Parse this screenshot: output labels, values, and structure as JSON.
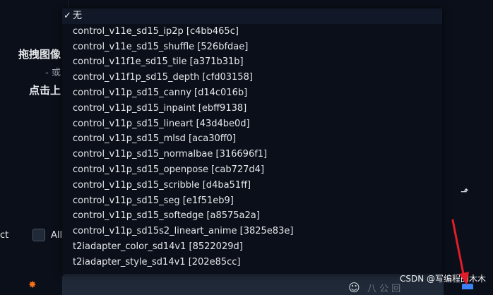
{
  "upload": {
    "line1": "拖拽图像",
    "line2": "- 或",
    "line3": "点击上"
  },
  "options": {
    "check_glyph": "✓",
    "items": [
      "无",
      "control_v11e_sd15_ip2p [c4bb465c]",
      "control_v11e_sd15_shuffle [526bfdae]",
      "control_v11f1e_sd15_tile [a371b31b]",
      "control_v11f1p_sd15_depth [cfd03158]",
      "control_v11p_sd15_canny [d14c016b]",
      "control_v11p_sd15_inpaint [ebff9138]",
      "control_v11p_sd15_lineart [43d4be0d]",
      "control_v11p_sd15_mlsd [aca30ff0]",
      "control_v11p_sd15_normalbae [316696f1]",
      "control_v11p_sd15_openpose [cab727d4]",
      "control_v11p_sd15_scribble [d4ba51ff]",
      "control_v11p_sd15_seg [e1f51eb9]",
      "control_v11p_sd15_softedge [a8575a2a]",
      "control_v11p_sd15s2_lineart_anime [3825e83e]",
      "t2iadapter_color_sd14v1 [8522029d]",
      "t2iadapter_style_sd14v1 [202e85cc]"
    ]
  },
  "left_text": "ct",
  "all_label": "All",
  "share_glyph": "⬏",
  "bottom": {
    "spark_glyph": "✸",
    "smile_glyph": "☺",
    "faded_text": "八 公 回"
  },
  "watermark": "CSDN @写编程的木木",
  "colors": {
    "background": "#0b0f19",
    "arrow": "#e11d2a",
    "tray": "#3b82f6"
  },
  "icons": [
    "check-icon",
    "share-icon",
    "spark-icon",
    "smile-icon",
    "tray-icon",
    "arrow-annotation"
  ]
}
